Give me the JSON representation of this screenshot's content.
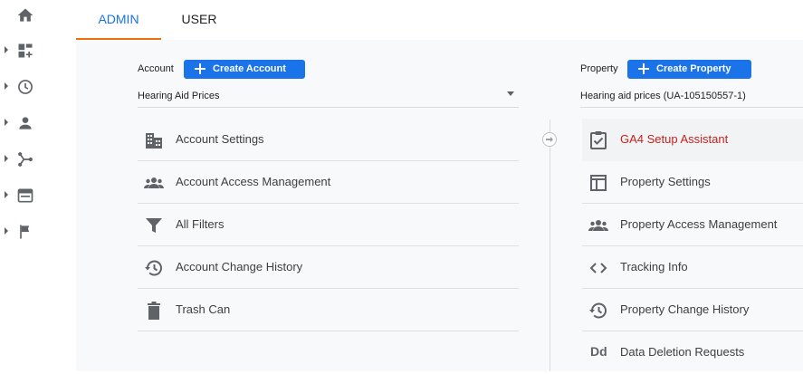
{
  "tabs": {
    "admin": "ADMIN",
    "user": "USER"
  },
  "account": {
    "label": "Account",
    "create_button": "Create Account",
    "selected": "Hearing Aid Prices",
    "items": [
      {
        "label": "Account Settings",
        "icon": "building-icon"
      },
      {
        "label": "Account Access Management",
        "icon": "people-icon"
      },
      {
        "label": "All Filters",
        "icon": "filter-icon"
      },
      {
        "label": "Account Change History",
        "icon": "history-icon"
      },
      {
        "label": "Trash Can",
        "icon": "trash-icon"
      }
    ]
  },
  "property": {
    "label": "Property",
    "create_button": "Create Property",
    "selected": "Hearing aid prices (UA-105150557-1)",
    "items": [
      {
        "label": "GA4 Setup Assistant",
        "icon": "checklist-icon",
        "active": true
      },
      {
        "label": "Property Settings",
        "icon": "layout-icon"
      },
      {
        "label": "Property Access Management",
        "icon": "people-icon"
      },
      {
        "label": "Tracking Info",
        "icon": "code-icon"
      },
      {
        "label": "Property Change History",
        "icon": "history-icon"
      },
      {
        "label": "Data Deletion Requests",
        "icon": "dd-icon",
        "glyph": "Dd"
      }
    ]
  },
  "colors": {
    "accent": "#1a73e8",
    "tab_indicator": "#e8710a",
    "active_text": "#c5221f"
  }
}
